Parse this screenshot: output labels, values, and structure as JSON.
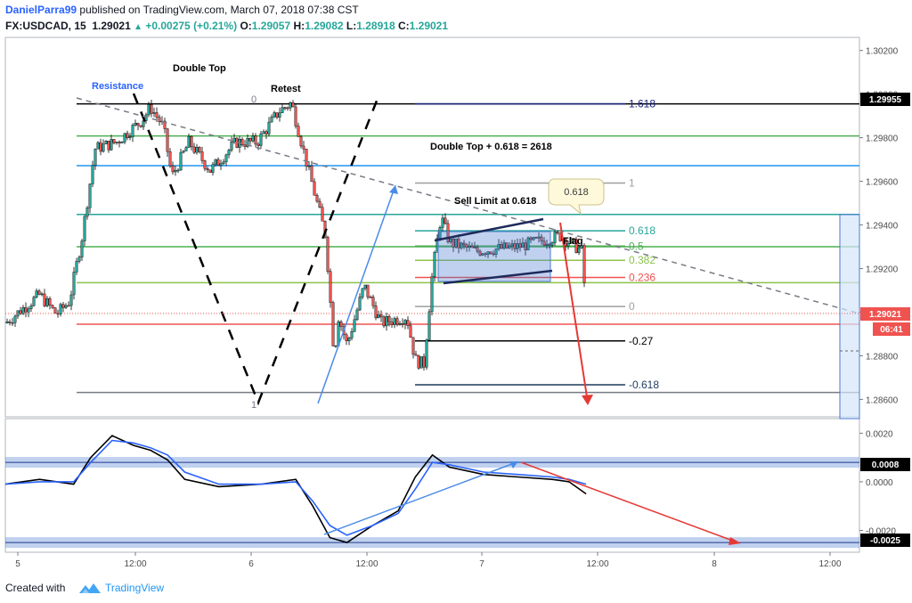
{
  "header": {
    "author": "DanielParra99",
    "published_text": "published on TradingView.com, March 07, 2018 07:38 CST",
    "symbol": "FX:USDCAD, 15",
    "last_price": "1.29021",
    "change": "+0.00275 (+0.21%)",
    "open_label": "O:",
    "open": "1.29057",
    "high_label": "H:",
    "high": "1.29082",
    "low_label": "L:",
    "low": "1.28918",
    "close_label": "C:",
    "close": "1.29021"
  },
  "footer": {
    "created_with": "Created with",
    "brand": "TradingView"
  },
  "annotations": {
    "double_top": "Double Top",
    "resistance": "Resistance",
    "retest": "Retest",
    "zero_left": "0",
    "one_left": "1",
    "formula": "Double Top + 0.618 = 2618",
    "sell_limit": "Sell Limit at 0.618",
    "bubble": "0.618",
    "flag": "Flag"
  },
  "colors": {
    "up": "#26a69a",
    "down": "#ef5350",
    "green_line": "#4caf50",
    "blue_line": "#2196f3",
    "red_line": "#ef5350",
    "box": "#4a7bd0"
  },
  "chart_data": [
    {
      "type": "candlestick",
      "symbol": "FX:USDCAD",
      "timeframe": "15",
      "price_axis_ticks": [
        "1.30200",
        "1.30000",
        "1.29800",
        "1.29600",
        "1.29400",
        "1.29200",
        "1.29000",
        "1.28800",
        "1.28600"
      ],
      "ylim": [
        1.2852,
        1.3026
      ],
      "time_axis_ticks": [
        "5",
        "12:00",
        "6",
        "12:00",
        "7",
        "12:00",
        "8",
        "12:00"
      ],
      "price_labels": {
        "resistance": "1.29955",
        "current": "1.29021",
        "countdown": "06:41"
      },
      "horizontal_levels": [
        {
          "name": "resistance",
          "price": 1.29955,
          "color": "#000000"
        },
        {
          "name": "green-1",
          "price": 1.29808,
          "color": "#4caf50"
        },
        {
          "name": "blue-1",
          "price": 1.29672,
          "color": "#2196f3"
        },
        {
          "name": "teal-1",
          "price": 1.29448,
          "color": "#26a69a"
        },
        {
          "name": "green-2",
          "price": 1.293,
          "color": "#4caf50"
        },
        {
          "name": "lime-1",
          "price": 1.29135,
          "color": "#8bc34a"
        },
        {
          "name": "red-1",
          "price": 1.28945,
          "color": "#ef5350"
        },
        {
          "name": "grey-bottom",
          "price": 1.28632,
          "color": "#787b86"
        }
      ],
      "fib_levels": [
        {
          "label": "1.618",
          "price": 1.29955
        },
        {
          "label": "1",
          "price": 1.29592
        },
        {
          "label": "0.618",
          "price": 1.29373
        },
        {
          "label": "0.5",
          "price": 1.29303
        },
        {
          "label": "0.382",
          "price": 1.29238
        },
        {
          "label": "0.236",
          "price": 1.29159
        },
        {
          "label": "0",
          "price": 1.29026
        },
        {
          "label": "-0.27",
          "price": 1.28868
        },
        {
          "label": "-0.618",
          "price": 1.28667
        }
      ],
      "price_path": [
        [
          0,
          1.2895
        ],
        [
          0.04,
          1.2908
        ],
        [
          0.06,
          1.2899
        ],
        [
          0.075,
          1.2905
        ],
        [
          0.09,
          1.2935
        ],
        [
          0.105,
          1.2975
        ],
        [
          0.13,
          1.2978
        ],
        [
          0.16,
          1.2988
        ],
        [
          0.17,
          1.2994
        ],
        [
          0.185,
          1.2985
        ],
        [
          0.195,
          1.2962
        ],
        [
          0.215,
          1.2978
        ],
        [
          0.24,
          1.2965
        ],
        [
          0.27,
          1.2978
        ],
        [
          0.295,
          1.2978
        ],
        [
          0.32,
          1.2992
        ],
        [
          0.335,
          1.2996
        ],
        [
          0.355,
          1.2965
        ],
        [
          0.375,
          1.2935
        ],
        [
          0.385,
          1.288
        ],
        [
          0.39,
          1.2898
        ],
        [
          0.4,
          1.2885
        ],
        [
          0.42,
          1.2912
        ],
        [
          0.44,
          1.2895
        ],
        [
          0.47,
          1.2898
        ],
        [
          0.48,
          1.2878
        ],
        [
          0.49,
          1.2876
        ],
        [
          0.5,
          1.2918
        ],
        [
          0.51,
          1.2944
        ],
        [
          0.52,
          1.2932
        ],
        [
          0.55,
          1.2928
        ],
        [
          0.6,
          1.293
        ],
        [
          0.65,
          1.2935
        ],
        [
          0.675,
          1.2928
        ],
        [
          0.68,
          1.2902
        ]
      ]
    },
    {
      "type": "line",
      "name": "oscillator",
      "axis_ticks": [
        "0.0020",
        "0.0000",
        "-0.0020"
      ],
      "ylim": [
        -0.0029,
        0.0026
      ],
      "labels": {
        "upper": "0.0008",
        "lower": "-0.0025"
      },
      "levels": [
        0.0008,
        -0.0025
      ],
      "series": [
        {
          "color": "#000000",
          "values": [
            [
              0,
              -0.0001
            ],
            [
              0.04,
              0.0001
            ],
            [
              0.08,
              -0.0001
            ],
            [
              0.1,
              0.001
            ],
            [
              0.125,
              0.0019
            ],
            [
              0.15,
              0.0015
            ],
            [
              0.17,
              0.0013
            ],
            [
              0.19,
              0.0009
            ],
            [
              0.21,
              0.0001
            ],
            [
              0.25,
              -0.0002
            ],
            [
              0.3,
              -0.0001
            ],
            [
              0.34,
              0.0001
            ],
            [
              0.36,
              -0.001
            ],
            [
              0.38,
              -0.0023
            ],
            [
              0.4,
              -0.0025
            ],
            [
              0.43,
              -0.0018
            ],
            [
              0.46,
              -0.0012
            ],
            [
              0.48,
              0.0002
            ],
            [
              0.5,
              0.0011
            ],
            [
              0.52,
              0.0006
            ],
            [
              0.56,
              0.0003
            ],
            [
              0.6,
              0.0002
            ],
            [
              0.64,
              0.0001
            ],
            [
              0.66,
              0.0
            ],
            [
              0.68,
              -0.0005
            ]
          ]
        },
        {
          "color": "#2962ff",
          "values": [
            [
              0,
              -0.0001
            ],
            [
              0.04,
              0.0
            ],
            [
              0.08,
              0.0
            ],
            [
              0.1,
              0.0008
            ],
            [
              0.125,
              0.0017
            ],
            [
              0.15,
              0.0016
            ],
            [
              0.17,
              0.0014
            ],
            [
              0.19,
              0.0011
            ],
            [
              0.21,
              0.0004
            ],
            [
              0.25,
              -0.0001
            ],
            [
              0.3,
              -0.0001
            ],
            [
              0.34,
              0.0
            ],
            [
              0.36,
              -0.0008
            ],
            [
              0.38,
              -0.0018
            ],
            [
              0.4,
              -0.0022
            ],
            [
              0.43,
              -0.0018
            ],
            [
              0.46,
              -0.0013
            ],
            [
              0.48,
              -0.0003
            ],
            [
              0.5,
              0.0008
            ],
            [
              0.52,
              0.0007
            ],
            [
              0.56,
              0.0004
            ],
            [
              0.6,
              0.0003
            ],
            [
              0.64,
              0.0002
            ],
            [
              0.66,
              0.0001
            ],
            [
              0.68,
              -0.0001
            ]
          ]
        }
      ]
    }
  ]
}
